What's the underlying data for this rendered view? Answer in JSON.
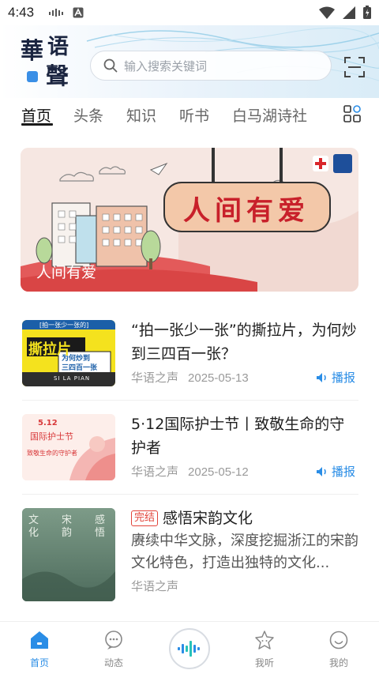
{
  "status_bar": {
    "time": "4:43"
  },
  "header": {
    "logo_chars": [
      "華",
      "语",
      "聲"
    ],
    "search_placeholder": "输入搜索关键词"
  },
  "tabs": [
    {
      "label": "首页",
      "active": true
    },
    {
      "label": "头条",
      "active": false
    },
    {
      "label": "知识",
      "active": false
    },
    {
      "label": "听书",
      "active": false
    },
    {
      "label": "白马湖诗社",
      "active": false
    }
  ],
  "banner": {
    "sign_text": "人间有爱",
    "caption": "人间有爱"
  },
  "articles": [
    {
      "title": "“拍一张少一张”的撕拉片，为何炒到三四百一张？",
      "source": "华语之声",
      "date": "2025-05-13",
      "play_label": "播报",
      "thumb_text": [
        "[拍一张少一张的]",
        "撕拉片",
        "为何炒到",
        "三四百一张",
        "SI LA PIAN"
      ]
    },
    {
      "title": "5·12国际护士节丨致敬生命的守护者",
      "source": "华语之声",
      "date": "2025-05-12",
      "play_label": "播报",
      "thumb_text": [
        "5.12",
        "国际护士节",
        "致敬生命的守护者"
      ]
    },
    {
      "badge": "完结",
      "title": "感悟宋韵文化",
      "description": "赓续中华文脉，深度挖掘浙江的宋韵文化特色，打造出独特的文化...",
      "source": "华语之声",
      "thumb_text": [
        "文化",
        "宋韵",
        "感悟"
      ]
    }
  ],
  "bottom_nav": [
    {
      "label": "首页",
      "icon": "home-icon",
      "active": true
    },
    {
      "label": "动态",
      "icon": "chat-icon",
      "active": false
    },
    {
      "label": "",
      "icon": "audio-wave-icon",
      "active": false
    },
    {
      "label": "我听",
      "icon": "star-face-icon",
      "active": false
    },
    {
      "label": "我的",
      "icon": "smile-icon",
      "active": false
    }
  ],
  "colors": {
    "accent": "#2a8de6",
    "badge_red": "#e2443a",
    "banner_red": "#c8202a"
  }
}
